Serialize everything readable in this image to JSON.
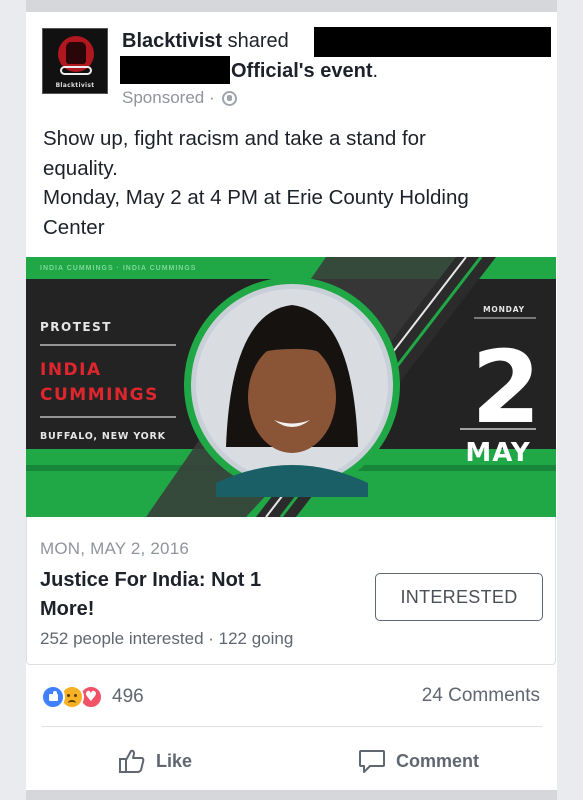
{
  "post": {
    "avatar_label": "Blacktivist",
    "page_name": "Blacktivist",
    "shared_word": "shared",
    "event_owner": "Official's event",
    "period": ".",
    "sponsored": "Sponsored ·",
    "text_lines": [
      "Show up, fight racism and take a stand for",
      "equality.",
      "Monday, May 2 at 4 PM at Erie County Holding",
      "Center"
    ]
  },
  "banner": {
    "top_strip_text": "INDIA CUMMINGS · INDIA CUMMINGS",
    "protest": "PROTEST",
    "name_line1": "INDIA",
    "name_line2": "CUMMINGS",
    "location": "BUFFALO, NEW YORK",
    "weekday": "MONDAY",
    "day": "2",
    "month": "MAY"
  },
  "event": {
    "date": "MON, MAY 2, 2016",
    "title_line1": "Justice For India: Not 1",
    "title_line2": "More!",
    "stats": "252 people interested · 122 going",
    "interested_label": "INTERESTED"
  },
  "footer": {
    "reaction_count": "496",
    "comment_count": "24 Comments",
    "like_label": "Like",
    "comment_label": "Comment"
  },
  "colors": {
    "banner_green": "#1fa845",
    "banner_dark": "#232323",
    "name_red": "#e0262d",
    "like_blue": "#4080ff",
    "love_red": "#f25268",
    "sad_yellow": "#f7b125"
  }
}
